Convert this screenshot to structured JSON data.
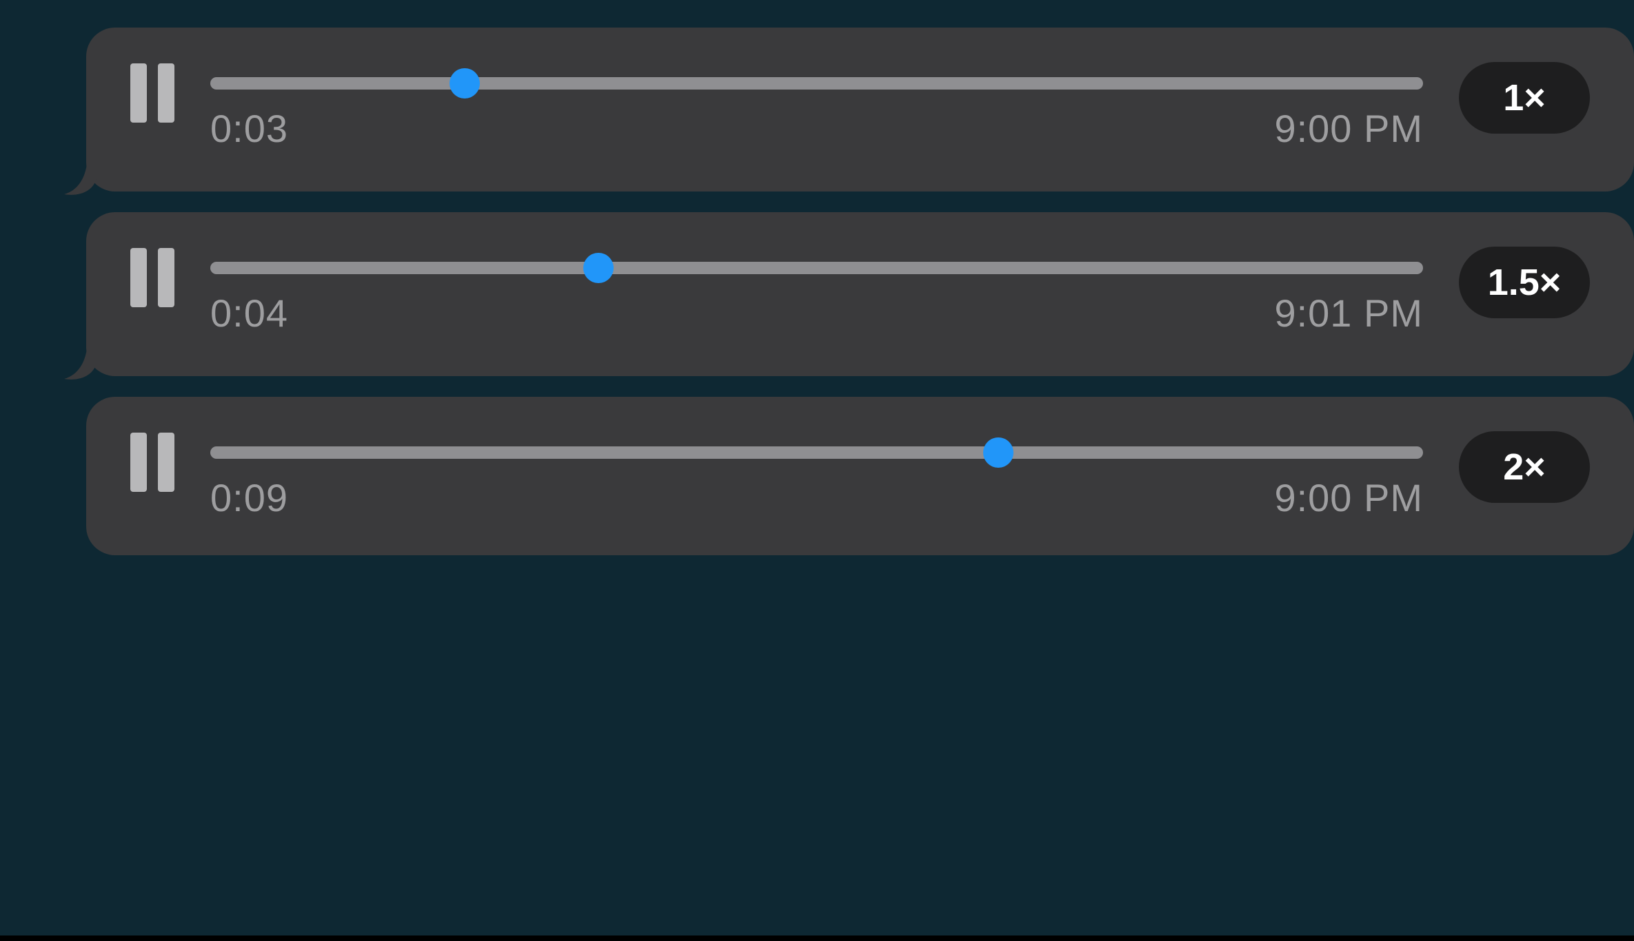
{
  "colors": {
    "background": "#0e2833",
    "bubble": "#3a3a3c",
    "track": "#8f8f92",
    "thumb": "#2196f9",
    "timeText": "#9e9ea0",
    "pauseBar": "#b8b8ba",
    "speedPill": "#1e1e1f",
    "speedText": "#ffffff"
  },
  "messages": [
    {
      "state": "playing",
      "icon": "pause-icon",
      "elapsed": "0:03",
      "timestamp": "9:00 PM",
      "progressPercent": 21,
      "speed": "1×"
    },
    {
      "state": "playing",
      "icon": "pause-icon",
      "elapsed": "0:04",
      "timestamp": "9:01 PM",
      "progressPercent": 32,
      "speed": "1.5×"
    },
    {
      "state": "playing",
      "icon": "pause-icon",
      "elapsed": "0:09",
      "timestamp": "9:00 PM",
      "progressPercent": 65,
      "speed": "2×"
    }
  ]
}
